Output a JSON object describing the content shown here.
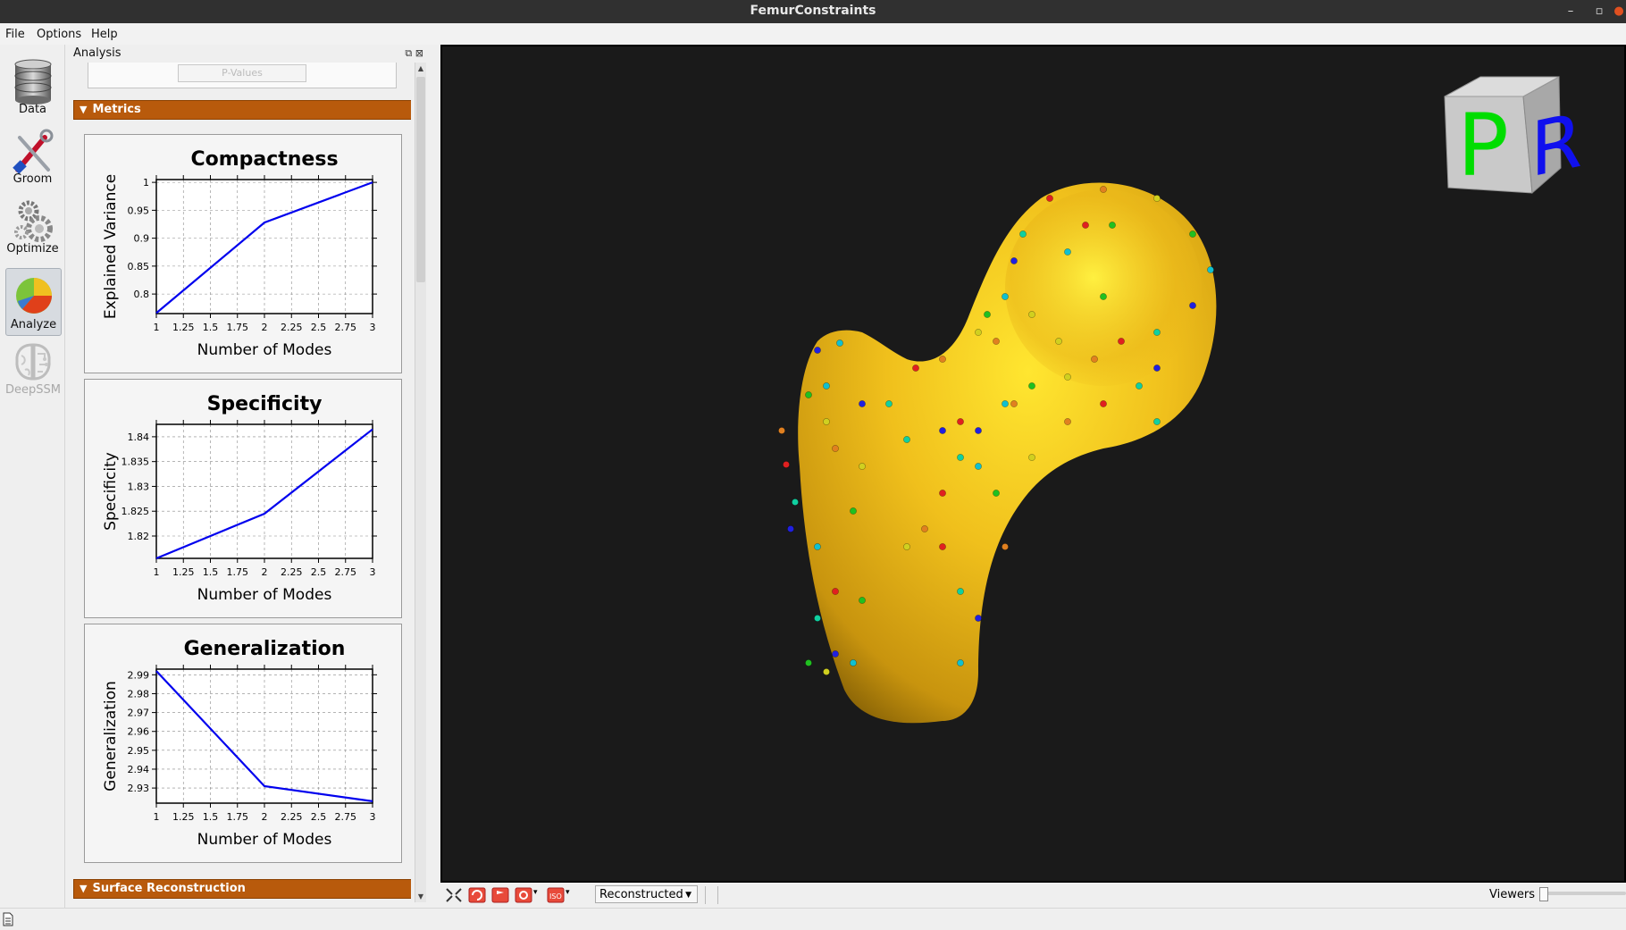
{
  "window": {
    "title": "FemurConstraints"
  },
  "menu": {
    "items": [
      "File",
      "Options",
      "Help"
    ]
  },
  "toolbar": {
    "tools": [
      {
        "label": "Data",
        "icon": "database-icon",
        "active": false,
        "enabled": true
      },
      {
        "label": "Groom",
        "icon": "tools-icon",
        "active": false,
        "enabled": true
      },
      {
        "label": "Optimize",
        "icon": "gears-icon",
        "active": false,
        "enabled": true
      },
      {
        "label": "Analyze",
        "icon": "pie-chart-icon",
        "active": true,
        "enabled": true
      },
      {
        "label": "DeepSSM",
        "icon": "brain-icon",
        "active": false,
        "enabled": false
      }
    ]
  },
  "dock": {
    "title": "Analysis",
    "pvalues_button": "P-Values",
    "sections": {
      "metrics": "Metrics",
      "surface": "Surface Reconstruction"
    }
  },
  "chart_data": [
    {
      "type": "line",
      "title": "Compactness",
      "xlabel": "Number of Modes",
      "ylabel": "Explained Variance",
      "x": [
        1,
        2,
        3
      ],
      "series": [
        {
          "values": [
            0.766,
            0.928,
            1.0
          ]
        }
      ],
      "xlim": [
        1,
        3
      ],
      "ylim": [
        0.765,
        1.005
      ],
      "xticks": [
        "1",
        "1.25",
        "1.5",
        "1.75",
        "2",
        "2.25",
        "2.5",
        "2.75",
        "3"
      ],
      "yticks": [
        0.8,
        0.85,
        0.9,
        0.95,
        1
      ],
      "yticklabels": [
        "0.8",
        "0.85",
        "0.9",
        "0.95",
        "1"
      ],
      "grid": true,
      "color": "#0000ee"
    },
    {
      "type": "line",
      "title": "Specificity",
      "xlabel": "Number of Modes",
      "ylabel": "Specificity",
      "x": [
        1,
        2,
        3
      ],
      "series": [
        {
          "values": [
            1.8155,
            1.8245,
            1.8415
          ]
        }
      ],
      "xlim": [
        1,
        3
      ],
      "ylim": [
        1.8155,
        1.8425
      ],
      "xticks": [
        "1",
        "1.25",
        "1.5",
        "1.75",
        "2",
        "2.25",
        "2.5",
        "2.75",
        "3"
      ],
      "yticks": [
        1.82,
        1.825,
        1.83,
        1.835,
        1.84
      ],
      "yticklabels": [
        "1.82",
        "1.825",
        "1.83",
        "1.835",
        "1.84"
      ],
      "grid": true,
      "color": "#0000ee"
    },
    {
      "type": "line",
      "title": "Generalization",
      "xlabel": "Number of Modes",
      "ylabel": "Generalization",
      "x": [
        1,
        2,
        3
      ],
      "series": [
        {
          "values": [
            2.992,
            2.931,
            2.923
          ]
        }
      ],
      "xlim": [
        1,
        3
      ],
      "ylim": [
        2.922,
        2.993
      ],
      "xticks": [
        "1",
        "1.25",
        "1.5",
        "1.75",
        "2",
        "2.25",
        "2.5",
        "2.75",
        "3"
      ],
      "yticks": [
        2.93,
        2.94,
        2.95,
        2.96,
        2.97,
        2.98,
        2.99
      ],
      "yticklabels": [
        "2.93",
        "2.94",
        "2.95",
        "2.96",
        "2.97",
        "2.98",
        "2.99"
      ],
      "grid": true,
      "color": "#0000ee"
    }
  ],
  "viewer": {
    "orientation_cube": {
      "front": "P",
      "side": "R",
      "front_color": "#00dd00",
      "side_color": "#1010ee"
    },
    "surface_color": "#e6b81a",
    "background": "#1a1a1a"
  },
  "bottom": {
    "view_mode": "Reconstructed",
    "viewers_label": "Viewers"
  },
  "colors": {
    "section_header": "#b85a0c",
    "plot_line": "#0000ee"
  }
}
